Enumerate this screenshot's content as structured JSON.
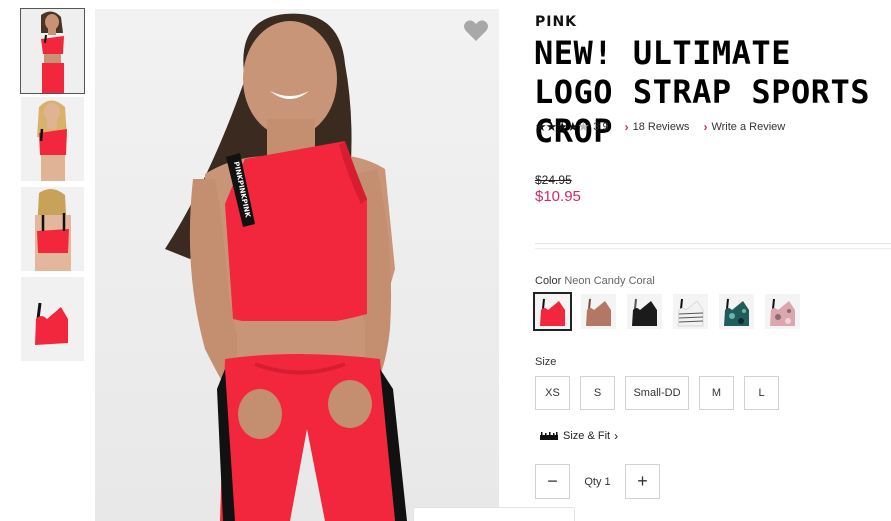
{
  "product": {
    "brand": "PINK",
    "title": "NEW! ULTIMATE LOGO STRAP SPORTS CROP",
    "rating": {
      "stars_filled": 4,
      "stars_total": 5,
      "value": "3.9",
      "reviews_label": "18 Reviews",
      "write_review_label": "Write a Review"
    },
    "price": {
      "original": "$24.95",
      "sale": "$10.95"
    }
  },
  "gallery": {
    "thumbnails": [
      {
        "name": "front-model",
        "selected": true
      },
      {
        "name": "front-model-alt",
        "selected": false
      },
      {
        "name": "back-model",
        "selected": false
      },
      {
        "name": "product-flat",
        "selected": false
      }
    ],
    "favorite_icon": "heart-icon"
  },
  "color": {
    "label": "Color",
    "selected_name": "Neon Candy Coral",
    "swatches": [
      {
        "name": "neon-candy-coral",
        "hex": "#f2263c",
        "selected": true
      },
      {
        "name": "mocha",
        "hex": "#b37865",
        "selected": false
      },
      {
        "name": "black",
        "hex": "#1b1b1b",
        "selected": false
      },
      {
        "name": "stripe",
        "hex": "#d9d9d9",
        "selected": false
      },
      {
        "name": "teal-camo",
        "hex": "#1f5c5a",
        "selected": false
      },
      {
        "name": "pink-camo",
        "hex": "#d9a7ad",
        "selected": false
      }
    ]
  },
  "size": {
    "label": "Size",
    "options": [
      "XS",
      "S",
      "Small-DD",
      "M",
      "L"
    ]
  },
  "fit": {
    "label": "Size & Fit",
    "icon": "ruler-icon"
  },
  "quantity": {
    "label": "Qty",
    "value": "1",
    "minus_icon": "minus-icon",
    "plus_icon": "plus-icon"
  },
  "colors": {
    "accent": "#d2286e",
    "product_red": "#f2263c"
  }
}
